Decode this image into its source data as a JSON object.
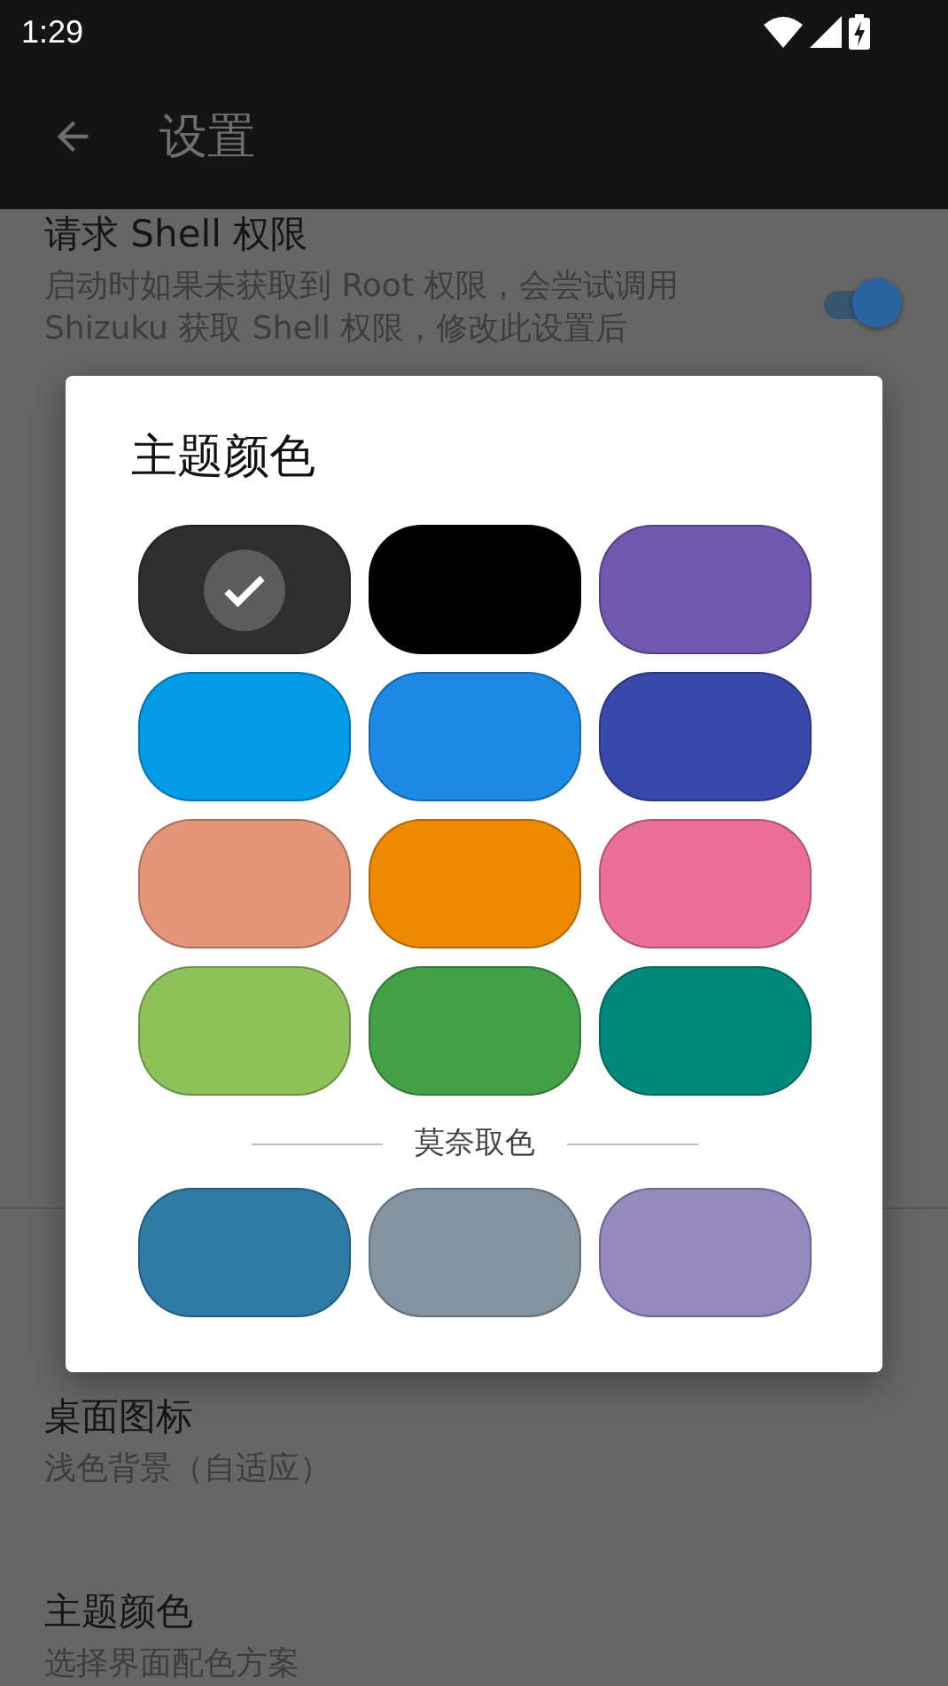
{
  "status_bar": {
    "time": "1:29"
  },
  "app_bar": {
    "title": "设置"
  },
  "settings": [
    {
      "kind": "switch",
      "title": "请求 Shell 权限",
      "summary": "启动时如果未获取到 Root 权限，会尝试调用 Shizuku 获取 Shell 权限，修改此设置后",
      "on": true
    },
    {
      "kind": "divider"
    },
    {
      "kind": "plain",
      "title": "桌面图标",
      "summary": "浅色背景（自适应）"
    },
    {
      "kind": "plain",
      "title": "主题颜色",
      "summary": "选择界面配色方案"
    }
  ],
  "dialog": {
    "title": "主题颜色",
    "swatches": [
      {
        "color": "#2f2f2f",
        "selected": true
      },
      {
        "color": "#000000",
        "selected": false
      },
      {
        "color": "#7057b0",
        "selected": false
      },
      {
        "color": "#039be5",
        "selected": false
      },
      {
        "color": "#1e88e5",
        "selected": false
      },
      {
        "color": "#3949ab",
        "selected": false
      },
      {
        "color": "#e5967a",
        "selected": false
      },
      {
        "color": "#ef8a00",
        "selected": false
      },
      {
        "color": "#ec6f99",
        "selected": false
      },
      {
        "color": "#8fc15a",
        "selected": false
      },
      {
        "color": "#43a047",
        "selected": false
      },
      {
        "color": "#00897b",
        "selected": false
      }
    ],
    "monet_label": "莫奈取色",
    "monet_swatches": [
      {
        "color": "#2e7ba6",
        "selected": false
      },
      {
        "color": "#8393a0",
        "selected": false
      },
      {
        "color": "#9488bd",
        "selected": false
      }
    ]
  }
}
